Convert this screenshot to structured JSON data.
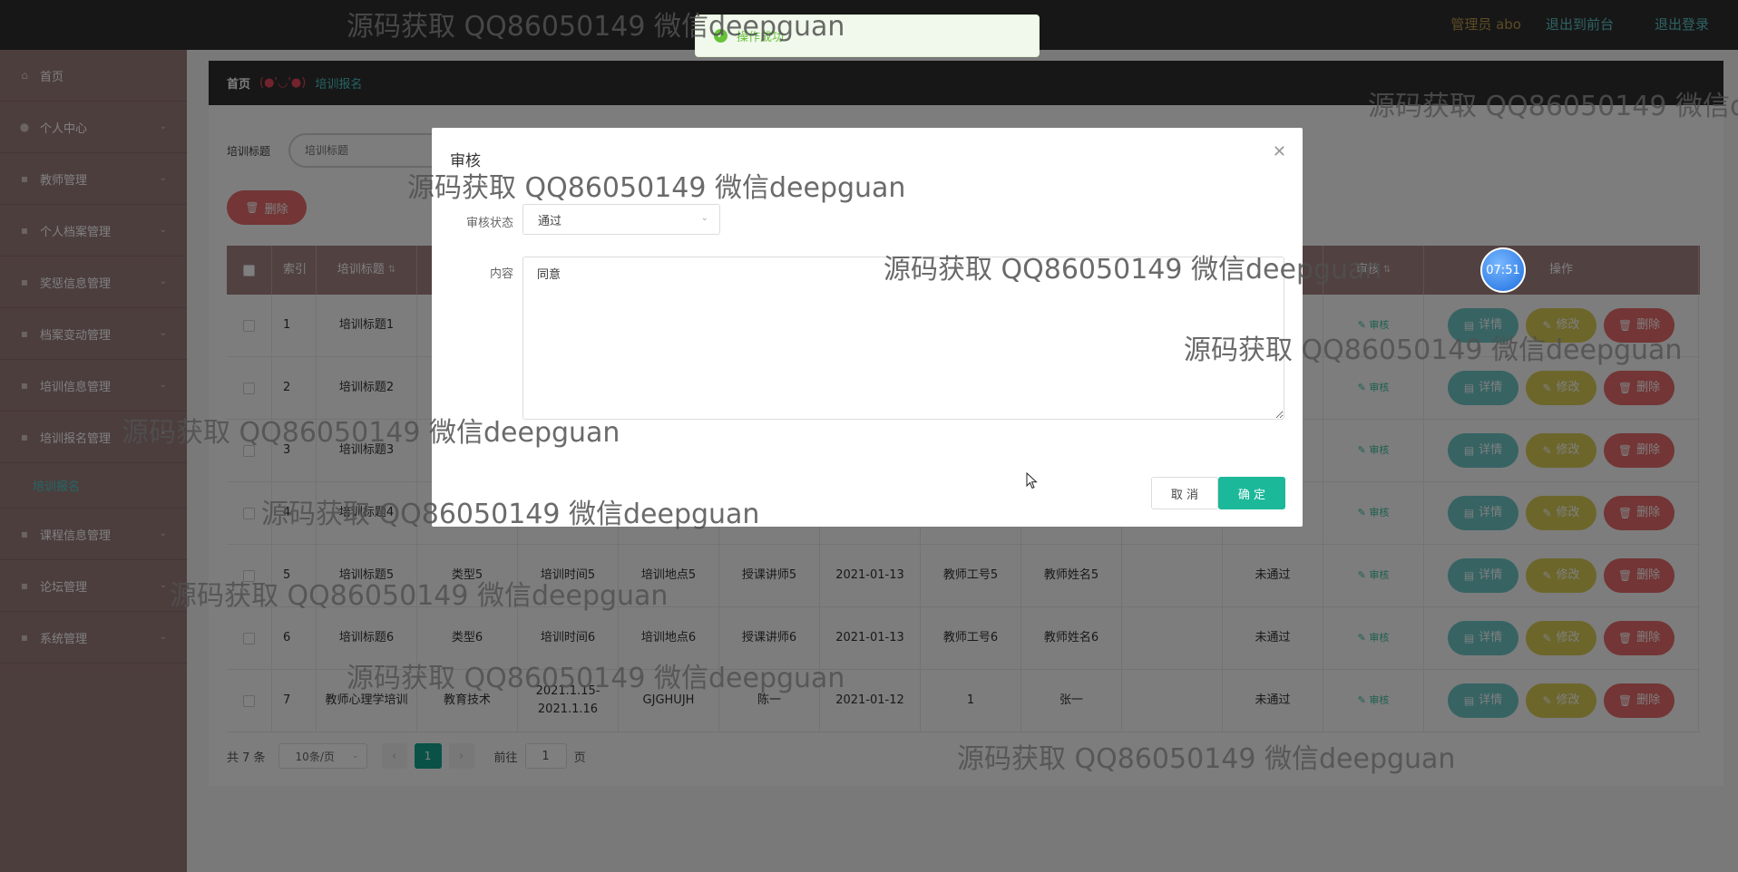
{
  "header": {
    "admin_label": "管理员 abo",
    "front_link": "退出到前台",
    "logout_link": "退出登录"
  },
  "sidebar": {
    "items": [
      {
        "label": "首页",
        "icon": "home-icon"
      },
      {
        "label": "个人中心",
        "icon": "user-icon"
      },
      {
        "label": "教师管理",
        "icon": "menu-icon"
      },
      {
        "label": "个人档案管理",
        "icon": "menu-icon"
      },
      {
        "label": "奖惩信息管理",
        "icon": "menu-icon"
      },
      {
        "label": "档案变动管理",
        "icon": "menu-icon"
      },
      {
        "label": "培训信息管理",
        "icon": "menu-icon"
      },
      {
        "label": "培训报名管理",
        "icon": "menu-icon"
      },
      {
        "label": "课程信息管理",
        "icon": "menu-icon"
      },
      {
        "label": "论坛管理",
        "icon": "menu-icon"
      },
      {
        "label": "系统管理",
        "icon": "menu-icon"
      }
    ],
    "active_sub": "培训报名"
  },
  "breadcrumb": {
    "home": "首页",
    "face": "(●'◡'●)",
    "current": "培训报名"
  },
  "search": {
    "label": "培训标题",
    "placeholder": "培训标题"
  },
  "toolbar": {
    "delete_label": "删除"
  },
  "table": {
    "headers": {
      "index": "索引",
      "title": "培训标题",
      "audit": "审核",
      "ops": "操作"
    },
    "rows": [
      {
        "index": "1",
        "title": "培训标题1",
        "type": "",
        "time": "",
        "place": "",
        "lecturer": "",
        "date": "",
        "tno": "",
        "tname": "",
        "status": ""
      },
      {
        "index": "2",
        "title": "培训标题2",
        "type": "",
        "time": "",
        "place": "",
        "lecturer": "",
        "date": "",
        "tno": "",
        "tname": "",
        "status": ""
      },
      {
        "index": "3",
        "title": "培训标题3",
        "type": "",
        "time": "",
        "place": "",
        "lecturer": "",
        "date": "",
        "tno": "",
        "tname": "",
        "status": ""
      },
      {
        "index": "4",
        "title": "培训标题4",
        "type": "",
        "time": "",
        "place": "",
        "lecturer": "",
        "date": "",
        "tno": "",
        "tname": "",
        "status": ""
      },
      {
        "index": "5",
        "title": "培训标题5",
        "type": "类型5",
        "time": "培训时间5",
        "place": "培训地点5",
        "lecturer": "授课讲师5",
        "date": "2021-01-13",
        "tno": "教师工号5",
        "tname": "教师姓名5",
        "status": "未通过"
      },
      {
        "index": "6",
        "title": "培训标题6",
        "type": "类型6",
        "time": "培训时间6",
        "place": "培训地点6",
        "lecturer": "授课讲师6",
        "date": "2021-01-13",
        "tno": "教师工号6",
        "tname": "教师姓名6",
        "status": "未通过"
      },
      {
        "index": "7",
        "title": "教师心理学培训",
        "type": "教育技术",
        "time": "2021.1.15-2021.1.16",
        "place": "GJGHUJH",
        "lecturer": "陈一",
        "date": "2021-01-12",
        "tno": "1",
        "tname": "张一",
        "status": "未通过"
      }
    ],
    "audit_link": "审核",
    "detail_label": "详情",
    "edit_label": "修改",
    "delete_label": "删除"
  },
  "pager": {
    "total": "共 7 条",
    "page_size": "10条/页",
    "current_page": "1",
    "goto_prefix": "前往",
    "goto_value": "1",
    "goto_suffix": "页"
  },
  "dialog": {
    "title": "审核",
    "status_label": "审核状态",
    "status_value": "通过",
    "content_label": "内容",
    "content_value": "同意",
    "cancel_label": "取 消",
    "ok_label": "确 定"
  },
  "toast": {
    "message": "操作成功"
  },
  "clock": {
    "time": "07:51"
  },
  "watermark": {
    "text": "源码获取 QQ86050149 微信deepguan"
  },
  "colors": {
    "topbar": "#2e2e2e",
    "sidebar": "#9a7d7d",
    "table_header": "#a48383",
    "accent": "#1bb99a",
    "danger": "#e76b6b",
    "detail": "#6fc7c7",
    "edit": "#d8cd57"
  }
}
